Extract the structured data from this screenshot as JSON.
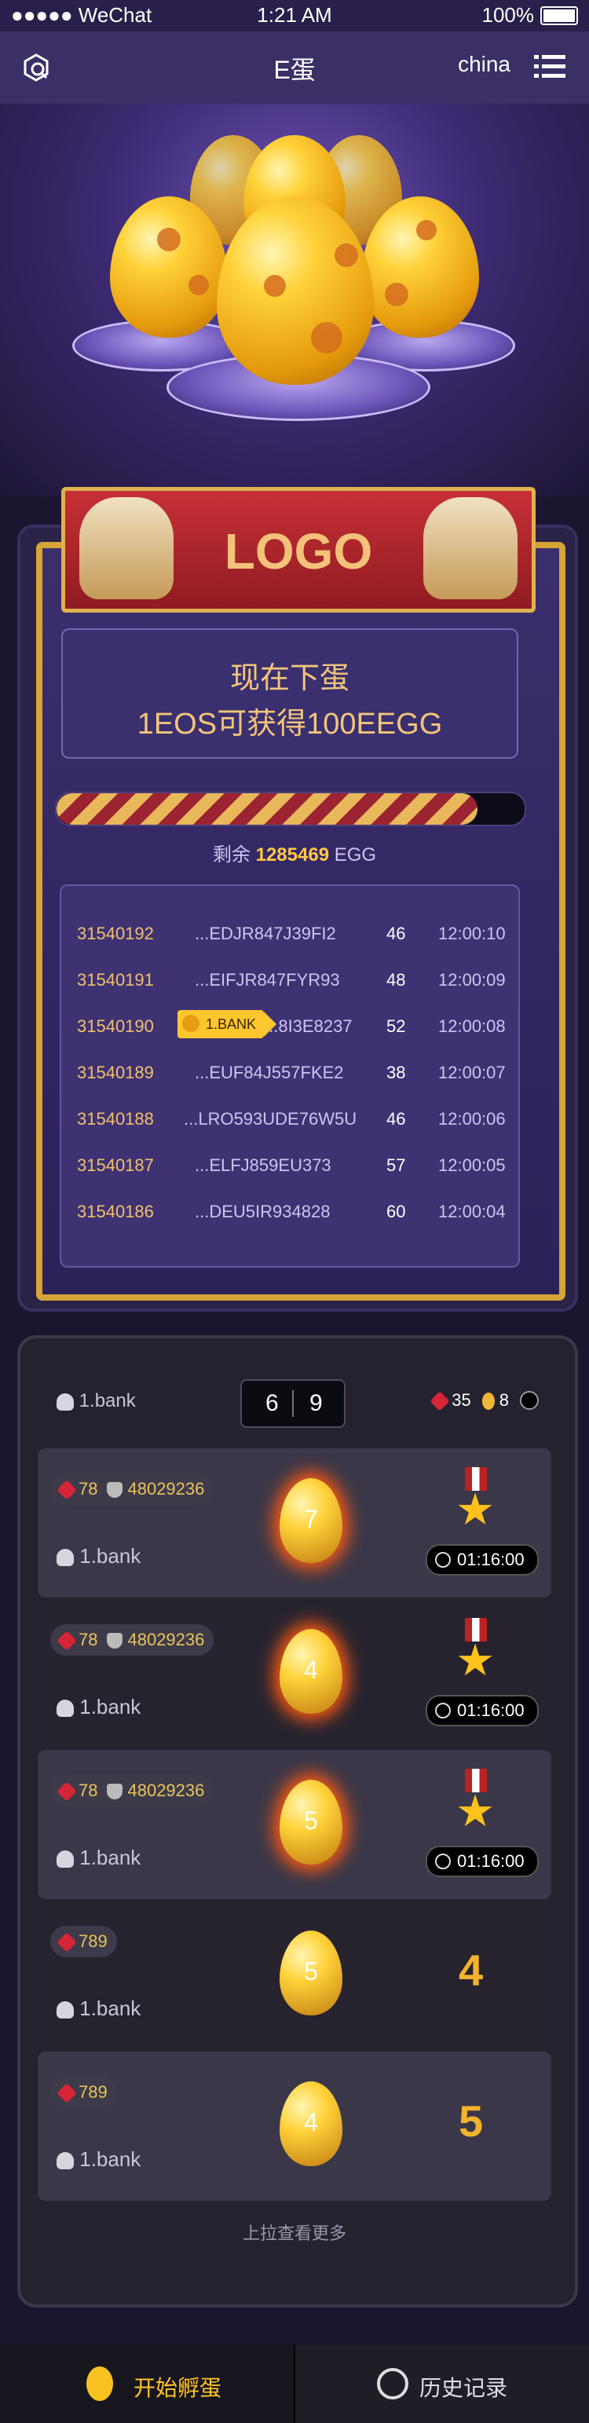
{
  "status": {
    "carrier": "●●●●● WeChat",
    "time": "1:21 AM",
    "battery": "100%"
  },
  "nav": {
    "title": "E蛋",
    "lang": "china"
  },
  "hero": {
    "logo": "LOGO"
  },
  "intro": {
    "line1": "现在下蛋",
    "line2": "1EOS可获得100EEGG"
  },
  "progress": {
    "fraction": 0.9
  },
  "remain": {
    "prefix": "剩余",
    "value": "1285469",
    "unit": "EGG"
  },
  "list": [
    {
      "id": "31540192",
      "hash": "...EDJR847J39FI2",
      "num": "46",
      "time": "12:00:10"
    },
    {
      "id": "31540191",
      "hash": "...EIFJR847FYR93",
      "num": "48",
      "time": "12:00:09"
    },
    {
      "id": "31540190",
      "hash": "...8I3E8237",
      "num": "52",
      "time": "12:00:08",
      "tag": "1.BANK"
    },
    {
      "id": "31540189",
      "hash": "...EUF84J557FKE2",
      "num": "38",
      "time": "12:00:07"
    },
    {
      "id": "31540188",
      "hash": "...LRO593UDE76W5U",
      "num": "46",
      "time": "12:00:06"
    },
    {
      "id": "31540187",
      "hash": "...ELFJ859EU373",
      "num": "57",
      "time": "12:00:05"
    },
    {
      "id": "31540186",
      "hash": "...DEU5IR934828",
      "num": "60",
      "time": "12:00:04"
    }
  ],
  "leader_head": {
    "user": "1.bank",
    "score_a": "6",
    "score_b": "9",
    "dice": "35",
    "eggs": "8"
  },
  "cards": [
    {
      "dice": "78",
      "shield": "48029236",
      "user": "1.bank",
      "egg": "7",
      "time": "01:16:00"
    },
    {
      "dice": "78",
      "shield": "48029236",
      "user": "1.bank",
      "egg": "4",
      "time": "01:16:00"
    },
    {
      "dice": "78",
      "shield": "48029236",
      "user": "1.bank",
      "egg": "5",
      "time": "01:16:00"
    },
    {
      "dice": "789",
      "user": "1.bank",
      "egg": "5",
      "rank": "4"
    },
    {
      "dice": "789",
      "user": "1.bank",
      "egg": "4",
      "rank": "5"
    }
  ],
  "more": "上拉查看更多",
  "tabs": {
    "left": "开始孵蛋",
    "right": "历史记录"
  }
}
